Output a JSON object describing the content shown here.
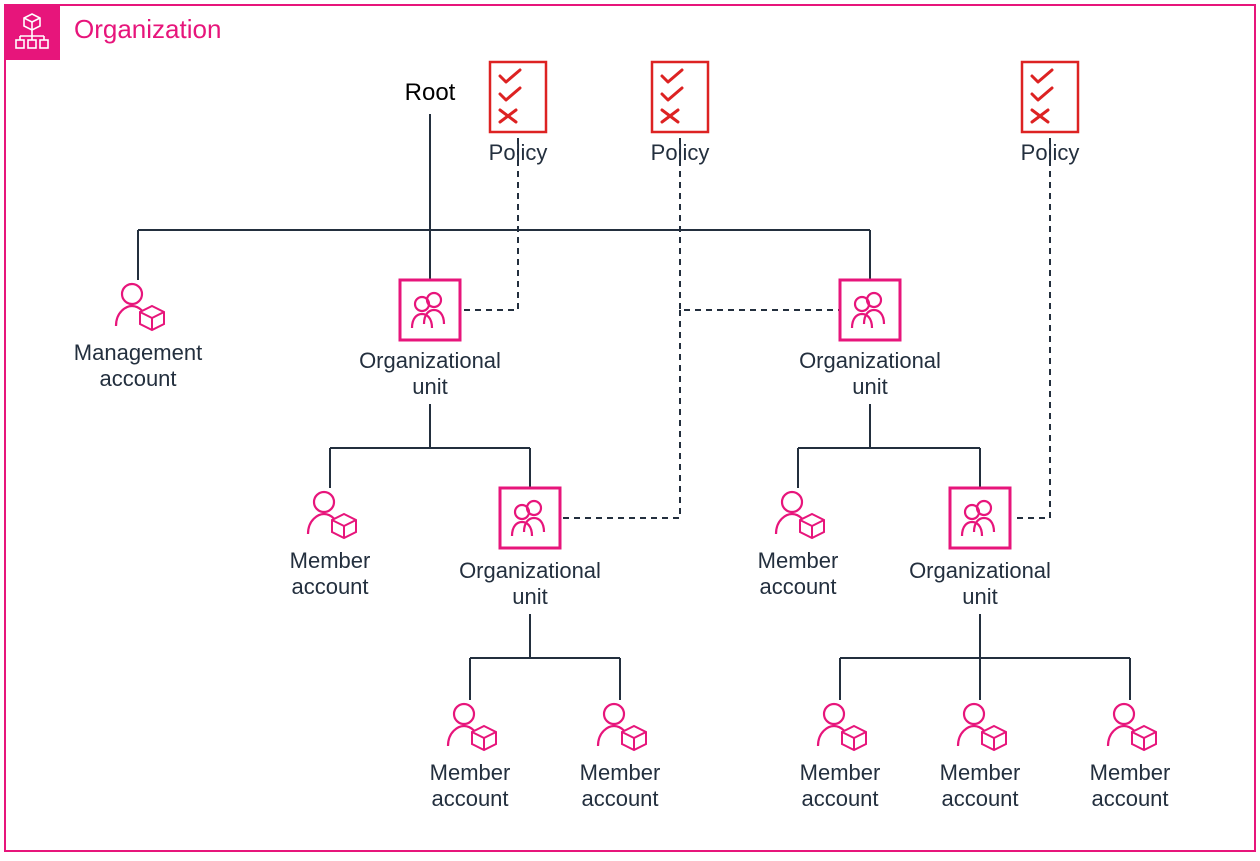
{
  "title": "Organization",
  "colors": {
    "brand": "#E7157B",
    "policy": "#E7157B",
    "policy_red": "#FF0000",
    "text": "#232F3E"
  },
  "root": {
    "label": "Root"
  },
  "policies": [
    {
      "id": "policy-1",
      "label": "Policy"
    },
    {
      "id": "policy-2",
      "label": "Policy"
    },
    {
      "id": "policy-3",
      "label": "Policy"
    }
  ],
  "management_account": {
    "label_l1": "Management",
    "label_l2": "account"
  },
  "ou_left": {
    "label_l1": "Organizational",
    "label_l2": "unit",
    "children": {
      "member": {
        "label_l1": "Member",
        "label_l2": "account"
      },
      "ou": {
        "label_l1": "Organizational",
        "label_l2": "unit",
        "members": [
          {
            "label_l1": "Member",
            "label_l2": "account"
          },
          {
            "label_l1": "Member",
            "label_l2": "account"
          }
        ]
      }
    }
  },
  "ou_right": {
    "label_l1": "Organizational",
    "label_l2": "unit",
    "children": {
      "member": {
        "label_l1": "Member",
        "label_l2": "account"
      },
      "ou": {
        "label_l1": "Organizational",
        "label_l2": "unit",
        "members": [
          {
            "label_l1": "Member",
            "label_l2": "account"
          },
          {
            "label_l1": "Member",
            "label_l2": "account"
          },
          {
            "label_l1": "Member",
            "label_l2": "account"
          }
        ]
      }
    }
  }
}
